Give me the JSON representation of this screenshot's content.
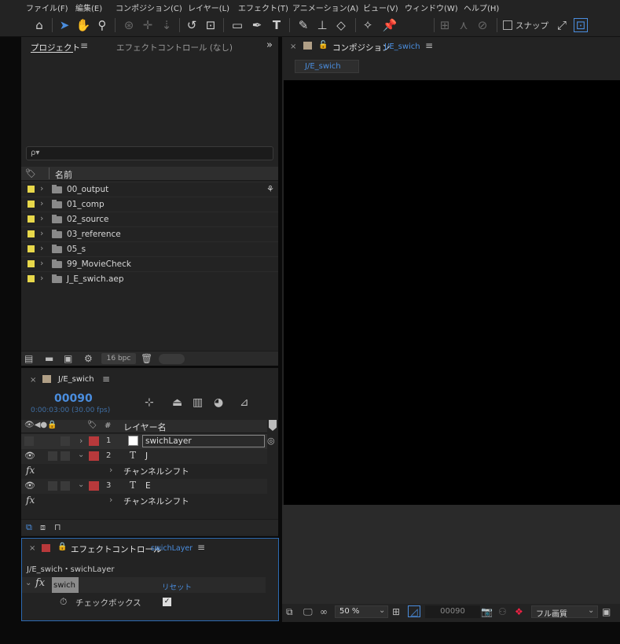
{
  "menu": [
    "ファイル(F)",
    "編集(E)",
    "コンポジション(C)",
    "レイヤー(L)",
    "エフェクト(T)",
    "アニメーション(A)",
    "ビュー(V)",
    "ウィンドウ(W)",
    "ヘルプ(H)"
  ],
  "toolbar": {
    "snap_label": "スナップ"
  },
  "project": {
    "tab_project": "プロジェクト",
    "tab_effects": "エフェクトコントロール (なし)",
    "search_placeholder": "ρ▾",
    "col_name": "名前",
    "items": [
      "00_output",
      "01_comp",
      "02_source",
      "03_reference",
      "05_s",
      "99_MovieCheck",
      "J_E_swich.aep"
    ],
    "bpc": "16 bpc"
  },
  "comp_viewer": {
    "title_prefix": "コンポジション",
    "comp_name": "J/E_swich",
    "tab": "J/E_swich",
    "zoom": "50 %",
    "timecode": "00090",
    "quality": "フル画質"
  },
  "timeline": {
    "comp_name": "J/E_swich",
    "timecode": "00090",
    "sub_timecode": "0:00:03:00 (30.00 fps)",
    "col_num": "#",
    "col_layer": "レイヤー名",
    "layers": [
      {
        "num": "1",
        "name": "swichLayer"
      },
      {
        "num": "2",
        "name": "J"
      },
      {
        "num": "3",
        "name": "E"
      }
    ],
    "fx_label": "fx",
    "effect_name": "チャンネルシフト"
  },
  "effects": {
    "title": "エフェクトコントロール",
    "layer": "swichLayer",
    "path": "J/E_swich・swichLayer",
    "fx_label": "fx",
    "effect": "swich",
    "reset": "リセット",
    "checkbox_label": "チェックボックス"
  },
  "colors": {
    "accent": "#4a8dde",
    "label_yellow": "#e8d84a",
    "label_red": "#b8393b"
  }
}
